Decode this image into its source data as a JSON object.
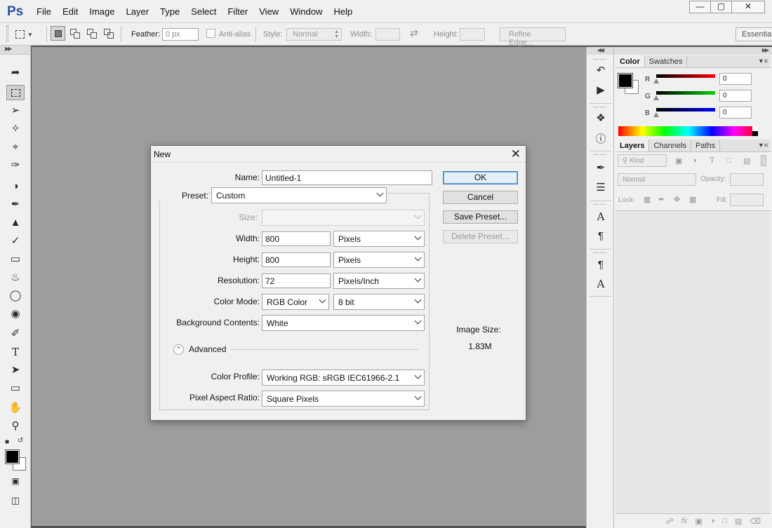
{
  "app": {
    "logo": "Ps",
    "menus": [
      "File",
      "Edit",
      "Image",
      "Layer",
      "Type",
      "Select",
      "Filter",
      "View",
      "Window",
      "Help"
    ],
    "window_controls": [
      "minimize",
      "maximize",
      "close"
    ]
  },
  "options_bar": {
    "feather_label": "Feather:",
    "feather_value": "0 px",
    "antialias_label": "Anti-alias",
    "style_label": "Style:",
    "style_value": "Normal",
    "width_label": "Width:",
    "height_label": "Height:",
    "refine_edge": "Refine Edge...",
    "workspace": "Essentials"
  },
  "tools": [
    "move-tool-icon",
    "marquee-tool-icon",
    "lasso-tool-icon",
    "quick-selection-tool-icon",
    "crop-tool-icon",
    "eyedropper-tool-icon",
    "healing-brush-tool-icon",
    "brush-tool-icon",
    "clone-stamp-tool-icon",
    "history-brush-tool-icon",
    "eraser-tool-icon",
    "paint-bucket-tool-icon",
    "blur-tool-icon",
    "dodge-tool-icon",
    "pen-tool-icon",
    "type-tool-icon",
    "path-selection-tool-icon",
    "rectangle-tool-icon",
    "hand-tool-icon",
    "zoom-tool-icon"
  ],
  "color_panel": {
    "tabs": [
      "Color",
      "Swatches"
    ],
    "r_label": "R",
    "g_label": "G",
    "b_label": "B",
    "r_value": "0",
    "g_value": "0",
    "b_value": "0"
  },
  "layers_panel": {
    "tabs": [
      "Layers",
      "Channels",
      "Paths"
    ],
    "kind_label": "Kind",
    "blend_mode": "Normal",
    "opacity_label": "Opacity:",
    "lock_label": "Lock:",
    "fill_label": "Fill:"
  },
  "dialog": {
    "title": "New",
    "name_label": "Name:",
    "name_value": "Untitled-1",
    "preset_label": "Preset:",
    "preset_value": "Custom",
    "size_label": "Size:",
    "width_label": "Width:",
    "width_value": "800",
    "width_unit": "Pixels",
    "height_label": "Height:",
    "height_value": "800",
    "height_unit": "Pixels",
    "resolution_label": "Resolution:",
    "resolution_value": "72",
    "resolution_unit": "Pixels/Inch",
    "color_mode_label": "Color Mode:",
    "color_mode_value": "RGB Color",
    "bit_depth": "8 bit",
    "background_label": "Background Contents:",
    "background_value": "White",
    "advanced_label": "Advanced",
    "color_profile_label": "Color Profile:",
    "color_profile_value": "Working RGB:  sRGB IEC61966-2.1",
    "aspect_label": "Pixel Aspect Ratio:",
    "aspect_value": "Square Pixels",
    "ok": "OK",
    "cancel": "Cancel",
    "save_preset": "Save Preset...",
    "delete_preset": "Delete Preset...",
    "image_size_label": "Image Size:",
    "image_size_value": "1.83M"
  },
  "colors": {
    "canvas": "#9d9d9d",
    "chrome": "#f0f0f0",
    "logo": "#2a4f9e",
    "ok_border": "#3b7fcc"
  }
}
